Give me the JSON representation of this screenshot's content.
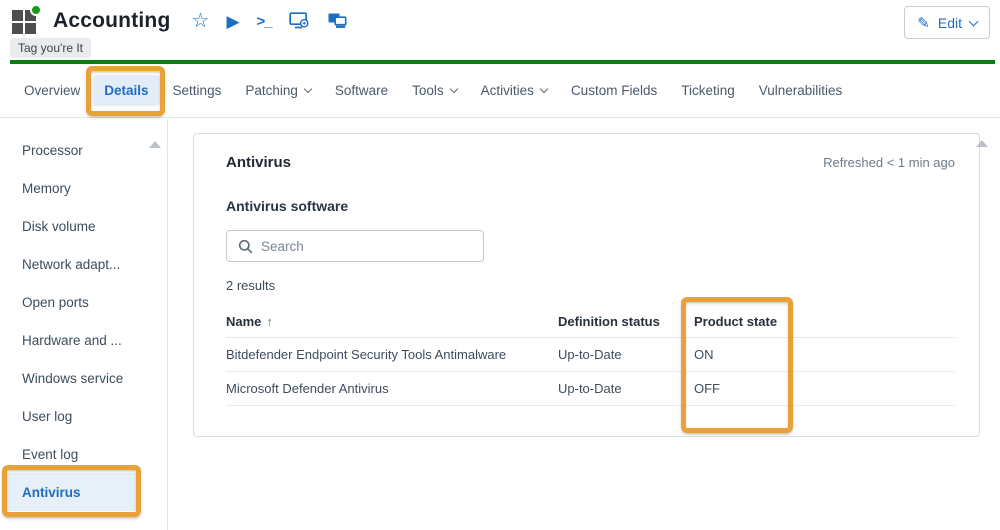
{
  "header": {
    "title": "Accounting",
    "tag": "Tag you're It",
    "edit_label": "Edit",
    "status": "online"
  },
  "icons": {
    "star": "☆",
    "play": "▶",
    "terminal": ">_",
    "pencil": "✎",
    "sort_asc": "↑"
  },
  "tabs": {
    "items": [
      {
        "label": "Overview"
      },
      {
        "label": "Details",
        "selected": true
      },
      {
        "label": "Settings"
      },
      {
        "label": "Patching",
        "dropdown": true
      },
      {
        "label": "Software"
      },
      {
        "label": "Tools",
        "dropdown": true
      },
      {
        "label": "Activities",
        "dropdown": true
      },
      {
        "label": "Custom Fields"
      },
      {
        "label": "Ticketing"
      },
      {
        "label": "Vulnerabilities"
      }
    ]
  },
  "sidebar": {
    "items": [
      {
        "label": "Processor"
      },
      {
        "label": "Memory"
      },
      {
        "label": "Disk volume"
      },
      {
        "label": "Network adapt..."
      },
      {
        "label": "Open ports"
      },
      {
        "label": "Hardware and ..."
      },
      {
        "label": "Windows service"
      },
      {
        "label": "User log"
      },
      {
        "label": "Event log"
      },
      {
        "label": "Antivirus",
        "selected": true
      }
    ]
  },
  "panel": {
    "title": "Antivirus",
    "refreshed": "Refreshed < 1 min ago",
    "section_title": "Antivirus software",
    "search_placeholder": "Search",
    "results_count": "2 results",
    "table": {
      "columns": [
        {
          "label": "Name",
          "sorted": "asc"
        },
        {
          "label": "Definition status"
        },
        {
          "label": "Product state",
          "annotated": true
        }
      ],
      "rows": [
        {
          "name": "Bitdefender Endpoint Security Tools Antimalware",
          "definition_status": "Up-to-Date",
          "product_state": "ON"
        },
        {
          "name": "Microsoft Defender Antivirus",
          "definition_status": "Up-to-Date",
          "product_state": "OFF"
        }
      ]
    }
  },
  "annotations": {
    "color": "#e9a23b",
    "boxes": [
      "details-tab",
      "product-state-column",
      "antivirus-sidebar-item"
    ]
  },
  "colors": {
    "accent_blue": "#1b6ec2",
    "green_bar": "#0c7d11",
    "selected_bg": "#e7eff8",
    "online_green": "#169a16"
  }
}
